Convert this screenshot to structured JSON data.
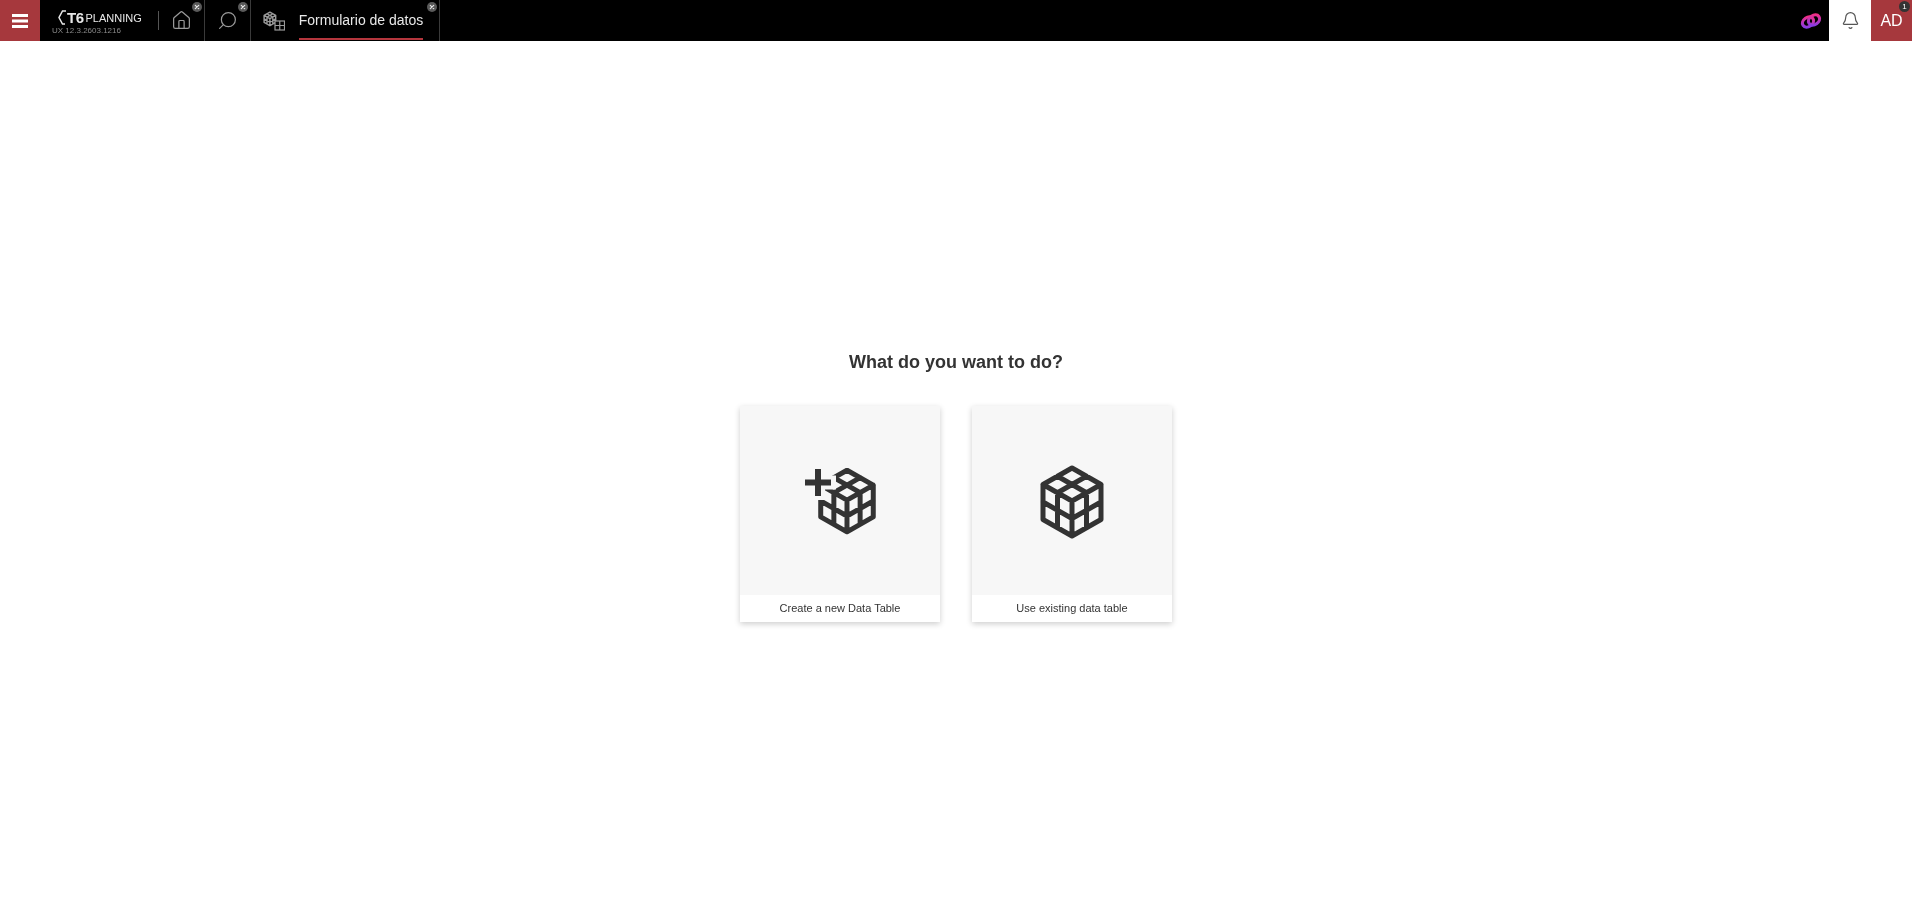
{
  "top_bar": {
    "logo": {
      "mark": "T6",
      "name": "PLANNING",
      "version": "UX 12.3.2603.1216"
    },
    "tabs": [
      {
        "kind": "home",
        "selected": false,
        "closable": true
      },
      {
        "kind": "search",
        "selected": false,
        "closable": true
      },
      {
        "kind": "data_form",
        "label": "Formulario de datos",
        "selected": true,
        "closable": true
      }
    ],
    "user": {
      "initials": "AD",
      "badge": "1"
    }
  },
  "main": {
    "heading": "What do you want to do?",
    "options": [
      {
        "kind": "create",
        "label": "Create a new Data Table"
      },
      {
        "kind": "existing",
        "label": "Use existing data table"
      }
    ]
  }
}
